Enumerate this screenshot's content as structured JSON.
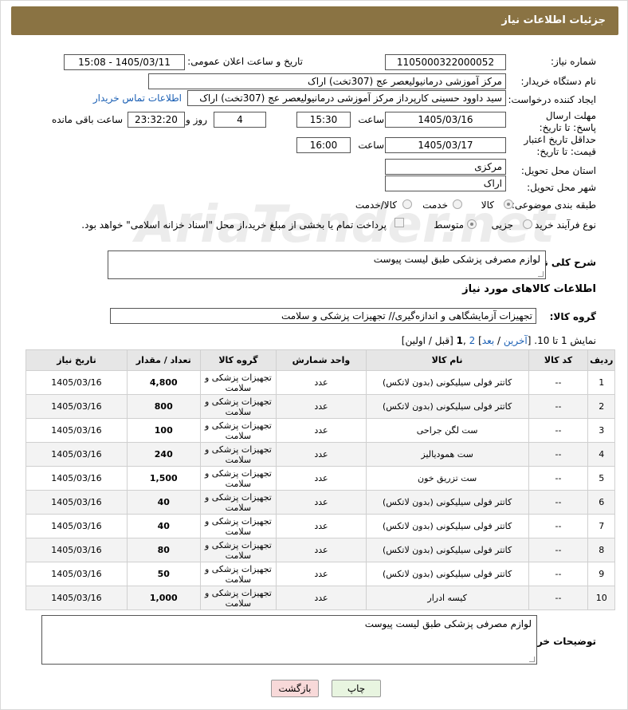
{
  "header": {
    "title": "جزئیات اطلاعات نیاز"
  },
  "watermark": "AriaTender.net",
  "fields": {
    "need_number_label": "شماره نیاز:",
    "need_number": "1105000322000052",
    "announce_label": "تاریخ و ساعت اعلان عمومی:",
    "announce_value": "1405/03/11 - 15:08",
    "buyer_org_label": "نام دستگاه خریدار:",
    "buyer_org": "مرکز آموزشی درمانیولیعصر عج (307تخت) اراک",
    "creator_label": "ایجاد کننده درخواست:",
    "creator": "سید داوود حسینی کارپرداز مرکز آموزشی درمانیولیعصر عج (307تخت) اراک",
    "contact_link": "اطلاعات تماس خریدار",
    "deadline_label": "مهلت ارسال پاسخ: تا تاریخ:",
    "deadline_date": "1405/03/16",
    "time_label": "ساعت",
    "deadline_time": "15:30",
    "days_value": "4",
    "days_label": "روز و",
    "remaining_time": "23:32:20",
    "remaining_label": "ساعت باقی مانده",
    "validity_label": "حداقل تاریخ اعتبار قیمت: تا تاریخ:",
    "validity_date": "1405/03/17",
    "validity_time": "16:00",
    "province_label": "استان محل تحویل:",
    "province": "مرکزی",
    "city_label": "شهر محل تحویل:",
    "city": "اراک",
    "category_label": "طبقه بندی موضوعی:",
    "category_options": [
      "کالا",
      "خدمت",
      "کالا/خدمت"
    ],
    "process_label": "نوع فرآیند خرید :",
    "process_options": [
      "جزیی",
      "متوسط"
    ],
    "payment_note": "پرداخت تمام یا بخشی از مبلغ خرید،از محل \"اسناد خزانه اسلامی\" خواهد بود.",
    "summary_label": "شرح کلی نیاز:",
    "summary_value": "لوازم مصرفی پزشکی طبق لیست پیوست",
    "goods_info_title": "اطلاعات کالاهای مورد نیاز",
    "goods_group_label": "گروه کالا:",
    "goods_group_value": "تجهیزات آزمایشگاهی و اندازه‌گیری// تجهیزات پزشکی و سلامت"
  },
  "pagination": {
    "prefix": "نمایش 1 تا 10. [",
    "last": "آخرین",
    "sep1": " / ",
    "next": "بعد",
    "bracket_close": "] ",
    "page2": "2",
    "comma": " ,",
    "page1": "1",
    "suffix": " [قبل / اولین]"
  },
  "table": {
    "headers": [
      "ردیف",
      "کد کالا",
      "نام کالا",
      "واحد شمارش",
      "گروه کالا",
      "تعداد / مقدار",
      "تاریخ نیاز"
    ],
    "rows": [
      [
        "1",
        "--",
        "کاتتر فولی سیلیکونی (بدون لاتکس)",
        "عدد",
        "تجهیزات پزشکی و سلامت",
        "4,800",
        "1405/03/16"
      ],
      [
        "2",
        "--",
        "کاتتر فولی سیلیکونی (بدون لاتکس)",
        "عدد",
        "تجهیزات پزشکی و سلامت",
        "800",
        "1405/03/16"
      ],
      [
        "3",
        "--",
        "ست لگن جراحی",
        "عدد",
        "تجهیزات پزشکی و سلامت",
        "100",
        "1405/03/16"
      ],
      [
        "4",
        "--",
        "ست همودیالیز",
        "عدد",
        "تجهیزات پزشکی و سلامت",
        "240",
        "1405/03/16"
      ],
      [
        "5",
        "--",
        "ست تزریق خون",
        "عدد",
        "تجهیزات پزشکی و سلامت",
        "1,500",
        "1405/03/16"
      ],
      [
        "6",
        "--",
        "کاتتر فولی سیلیکونی (بدون لاتکس)",
        "عدد",
        "تجهیزات پزشکی و سلامت",
        "40",
        "1405/03/16"
      ],
      [
        "7",
        "--",
        "کاتتر فولی سیلیکونی (بدون لاتکس)",
        "عدد",
        "تجهیزات پزشکی و سلامت",
        "40",
        "1405/03/16"
      ],
      [
        "8",
        "--",
        "کاتتر فولی سیلیکونی (بدون لاتکس)",
        "عدد",
        "تجهیزات پزشکی و سلامت",
        "80",
        "1405/03/16"
      ],
      [
        "9",
        "--",
        "کاتتر فولی سیلیکونی (بدون لاتکس)",
        "عدد",
        "تجهیزات پزشکی و سلامت",
        "50",
        "1405/03/16"
      ],
      [
        "10",
        "--",
        "کیسه ادرار",
        "عدد",
        "تجهیزات پزشکی و سلامت",
        "1,000",
        "1405/03/16"
      ]
    ]
  },
  "buyer_notes": {
    "label": "توضیحات خریدار:",
    "value": "لوازم مصرفی پزشکی طبق لیست پیوست"
  },
  "buttons": {
    "print": "چاپ",
    "back": "بازگشت"
  },
  "colors": {
    "header_bg": "#8a7343",
    "back_btn_bg": "#f8d9d9",
    "print_btn_bg": "#e8f5e0"
  }
}
